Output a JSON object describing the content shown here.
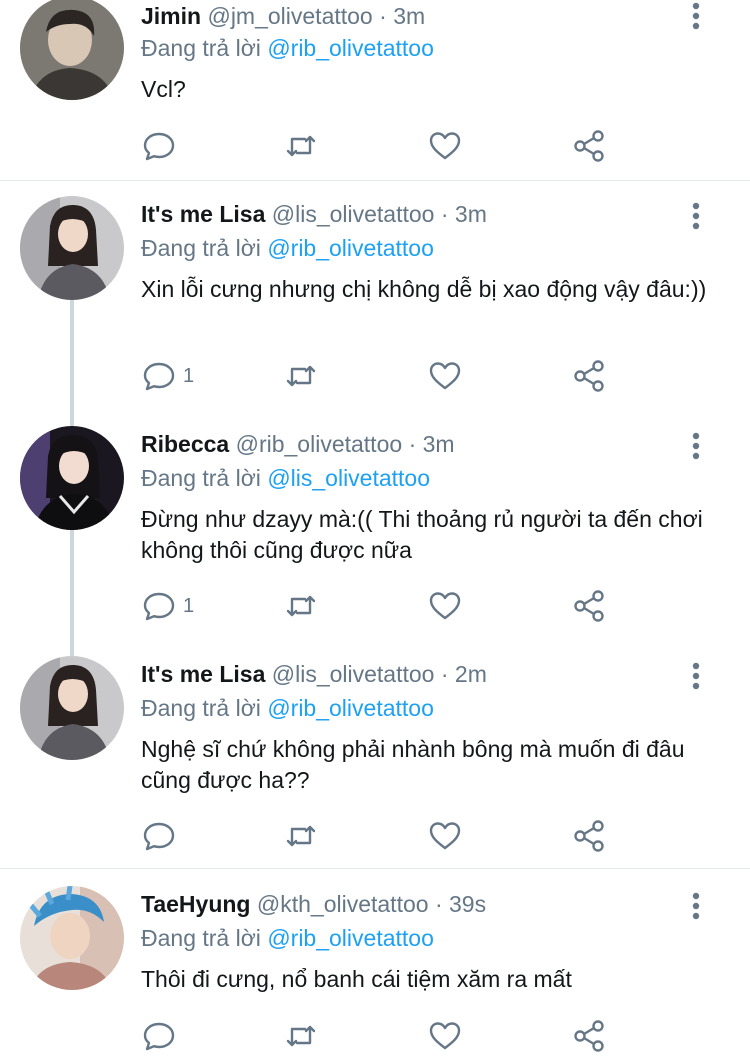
{
  "tweets": [
    {
      "name": "Jimin",
      "handle": "@jm_olivetattoo",
      "dot": "·",
      "time": "3m",
      "reply_prefix": "Đang trả lời",
      "reply_to": "@rib_olivetattoo",
      "text": "Vcl?",
      "reply_count": ""
    },
    {
      "name": "It's me Lisa",
      "handle": "@lis_olivetattoo",
      "dot": "·",
      "time": "3m",
      "reply_prefix": "Đang trả lời",
      "reply_to": "@rib_olivetattoo",
      "text": "Xin lỗi cưng nhưng chị không dễ bị xao động vậy đâu:))",
      "reply_count": "1"
    },
    {
      "name": "Ribecca",
      "handle": "@rib_olivetattoo",
      "dot": "·",
      "time": "3m",
      "reply_prefix": "Đang trả lời",
      "reply_to": "@lis_olivetattoo",
      "text": "Đừng như dzayy mà:(( Thi thoảng rủ người ta đến chơi không thôi cũng được nữa",
      "reply_count": "1"
    },
    {
      "name": "It's me Lisa",
      "handle": "@lis_olivetattoo",
      "dot": "·",
      "time": "2m",
      "reply_prefix": "Đang trả lời",
      "reply_to": "@rib_olivetattoo",
      "text": "Nghệ sĩ chứ không phải nhành bông mà muốn đi đâu cũng được ha??",
      "reply_count": ""
    },
    {
      "name": "TaeHyung",
      "handle": "@kth_olivetattoo",
      "dot": "·",
      "time": "39s",
      "reply_prefix": "Đang trả lời",
      "reply_to": "@rib_olivetattoo",
      "text": "Thôi đi cưng, nổ banh cái tiệm xăm ra mất",
      "reply_count": ""
    }
  ],
  "icons": {
    "reply": "reply-icon",
    "retweet": "retweet-icon",
    "like": "heart-icon",
    "share": "share-icon",
    "more": "more-vertical-icon"
  },
  "colors": {
    "name": "#14171a",
    "secondary": "#657786",
    "link": "#1da1f2",
    "divider": "#e1e8ed",
    "thread_line": "#ccd6dd"
  }
}
